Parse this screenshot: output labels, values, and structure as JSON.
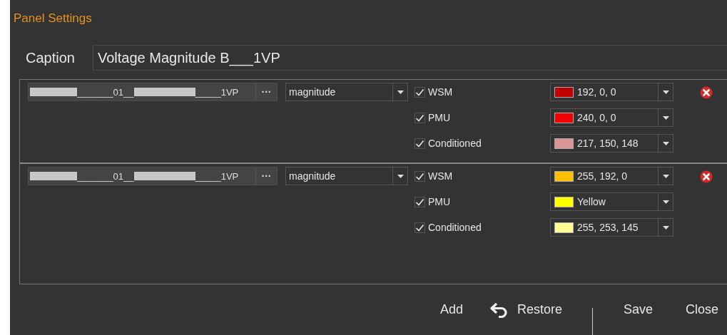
{
  "window": {
    "title": "Panel Settings"
  },
  "caption": {
    "label": "Caption",
    "value": "Voltage Magnitude B___1VP"
  },
  "signals": [
    {
      "path": [
        {
          "kind": "redacted"
        },
        {
          "kind": "text",
          "text": "_______01__"
        },
        {
          "kind": "redacted"
        },
        {
          "kind": "text",
          "text": "_____1VP"
        }
      ],
      "browse": "···",
      "quantity": "magnitude",
      "series": [
        {
          "label": "WSM",
          "checked": true,
          "color": "#c00000",
          "color_text": "192, 0, 0"
        },
        {
          "label": "PMU",
          "checked": true,
          "color": "#f00000",
          "color_text": "240, 0, 0"
        },
        {
          "label": "Conditioned",
          "checked": true,
          "color": "#d99694",
          "color_text": "217, 150, 148"
        }
      ]
    },
    {
      "path": [
        {
          "kind": "redacted"
        },
        {
          "kind": "text",
          "text": "_______01__"
        },
        {
          "kind": "redacted"
        },
        {
          "kind": "text",
          "text": "_____1VP"
        }
      ],
      "browse": "···",
      "quantity": "magnitude",
      "series": [
        {
          "label": "WSM",
          "checked": true,
          "color": "#ffc000",
          "color_text": "255, 192, 0"
        },
        {
          "label": "PMU",
          "checked": true,
          "color": "#ffff00",
          "color_text": "Yellow"
        },
        {
          "label": "Conditioned",
          "checked": true,
          "color": "#fffd91",
          "color_text": "255, 253, 145"
        }
      ]
    }
  ],
  "footer": {
    "add": "Add",
    "restore": "Restore",
    "save": "Save",
    "close": "Close"
  }
}
